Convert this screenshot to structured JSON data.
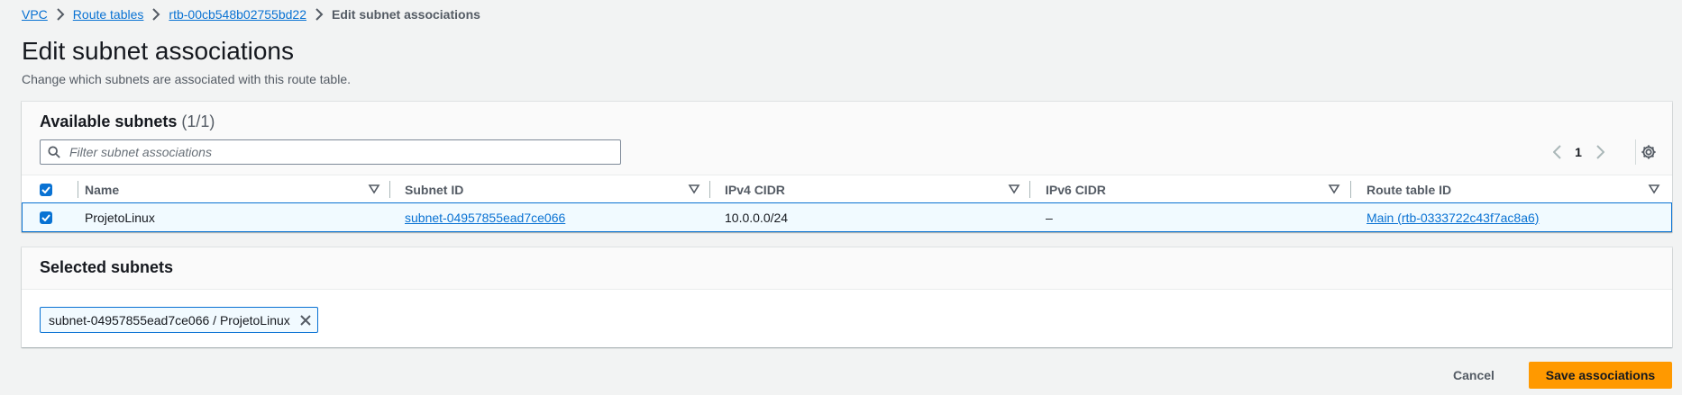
{
  "breadcrumb": {
    "items": [
      "VPC",
      "Route tables",
      "rtb-00cb548b02755bd22"
    ],
    "current": "Edit subnet associations"
  },
  "page": {
    "title": "Edit subnet associations",
    "subtitle": "Change which subnets are associated with this route table."
  },
  "available": {
    "title": "Available subnets",
    "count": "(1/1)",
    "filter_placeholder": "Filter subnet associations",
    "page_number": "1",
    "columns": [
      "Name",
      "Subnet ID",
      "IPv4 CIDR",
      "IPv6 CIDR",
      "Route table ID"
    ],
    "rows": [
      {
        "selected": true,
        "name": "ProjetoLinux",
        "subnet_id": "subnet-04957855ead7ce066",
        "ipv4": "10.0.0.0/24",
        "ipv6": "–",
        "route_table": "Main (rtb-0333722c43f7ac8a6)"
      }
    ]
  },
  "selected": {
    "title": "Selected subnets",
    "tokens": [
      "subnet-04957855ead7ce066 / ProjetoLinux"
    ]
  },
  "actions": {
    "cancel": "Cancel",
    "save": "Save associations"
  },
  "colors": {
    "link": "#0972d3",
    "primary_button": "#ff9900",
    "selected_row_bg": "#f1faff"
  },
  "icons": {
    "breadcrumb_separator": "chevron-right-icon",
    "search": "search-icon",
    "pager_prev": "chevron-left-icon",
    "pager_next": "chevron-right-icon",
    "settings": "gear-icon",
    "sort": "sort-caret-icon",
    "remove_token": "close-icon"
  }
}
